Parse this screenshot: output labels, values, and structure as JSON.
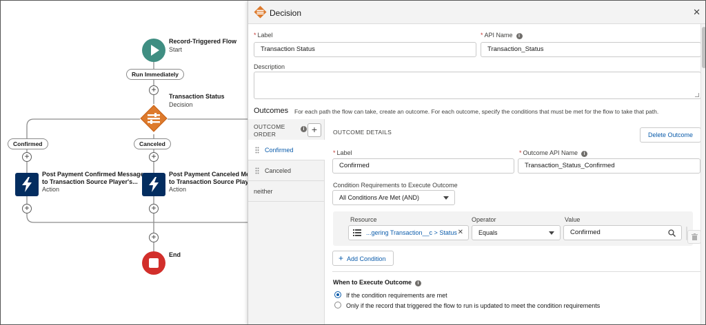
{
  "canvas": {
    "start": {
      "title": "Record-Triggered Flow",
      "subtitle": "Start"
    },
    "run_label": "Run Immediately",
    "decision": {
      "title": "Transaction Status",
      "subtitle": "Decision"
    },
    "branches": [
      {
        "label": "Confirmed",
        "action_title_1": "Post Payment Confirmed Message",
        "action_title_2": "to Transaction Source Player's...",
        "action_type": "Action"
      },
      {
        "label": "Canceled",
        "action_title_1": "Post Payment Canceled Me",
        "action_title_2": "to Transaction Source Play",
        "action_type": "Action"
      }
    ],
    "end_label": "End",
    "colors": {
      "start": "#3f8e82",
      "decision": "#dd7a2c",
      "action": "#032d60",
      "end": "#d22f2b"
    }
  },
  "panel": {
    "title": "Decision",
    "icon": "decision-icon",
    "label_field": {
      "label": "Label",
      "value": "Transaction Status"
    },
    "api_field": {
      "label": "API Name",
      "value": "Transaction_Status"
    },
    "description": {
      "label": "Description",
      "value": ""
    },
    "outcomes": {
      "title": "Outcomes",
      "help": "For each path the flow can take, create an outcome. For each outcome, specify the conditions that must be met for the flow to take that path.",
      "order_header_1": "OUTCOME",
      "order_header_2": "ORDER",
      "items": [
        "Confirmed",
        "Canceled",
        "neither"
      ]
    },
    "details": {
      "header": "OUTCOME DETAILS",
      "delete_label": "Delete Outcome",
      "label_field": {
        "label": "Label",
        "value": "Confirmed"
      },
      "api_field": {
        "label": "Outcome API Name",
        "value": "Transaction_Status_Confirmed"
      },
      "requirements": {
        "label": "Condition Requirements to Execute Outcome",
        "value": "All Conditions Are Met (AND)"
      },
      "condition": {
        "resource_label": "Resource",
        "resource_value": "...gering Transaction__c > Status",
        "operator_label": "Operator",
        "operator_value": "Equals",
        "value_label": "Value",
        "value_value": "Confirmed"
      },
      "add_condition": "Add Condition",
      "when": {
        "title": "When to Execute Outcome",
        "options": [
          "If the condition requirements are met",
          "Only if the record that triggered the flow to run is updated to meet the condition requirements"
        ]
      }
    }
  }
}
